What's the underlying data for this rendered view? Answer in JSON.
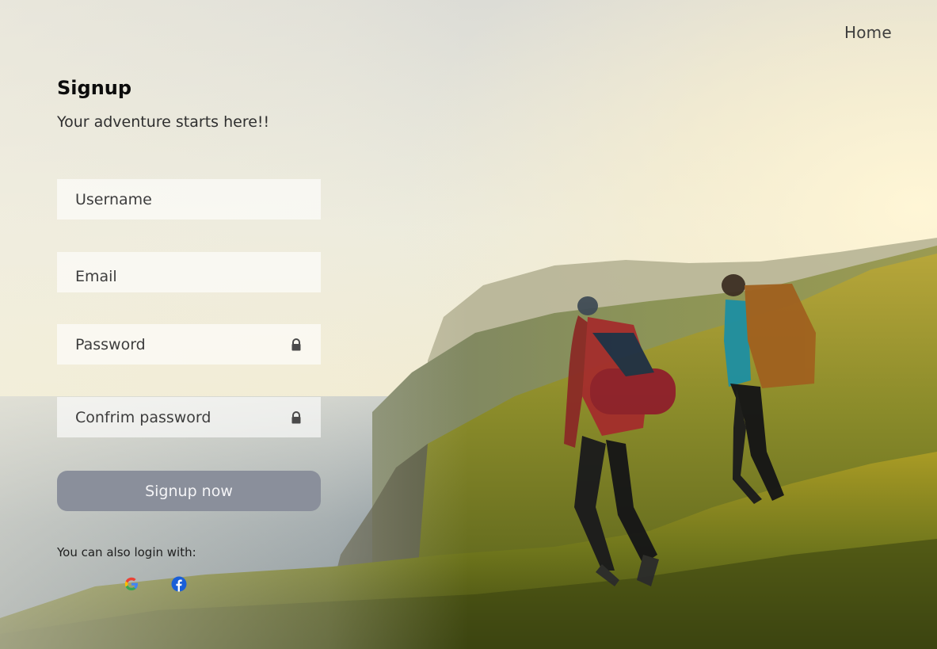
{
  "nav": {
    "home_label": "Home"
  },
  "form": {
    "title": "Signup",
    "subtitle": "Your adventure starts here!!",
    "username_placeholder": "Username",
    "email_placeholder": "Email",
    "password_placeholder": "Password",
    "confirm_placeholder": "Confrim password",
    "submit_label": "Signup now",
    "alt_login_text": "You can also login with:"
  },
  "icons": {
    "password_lock": "lock-icon",
    "confirm_lock": "lock-icon",
    "google": "google-icon",
    "facebook": "facebook-icon"
  },
  "colors": {
    "submit_bg": "#8a8f9b",
    "facebook_blue": "#1a5fd8",
    "title_text": "#0c0c0c"
  }
}
